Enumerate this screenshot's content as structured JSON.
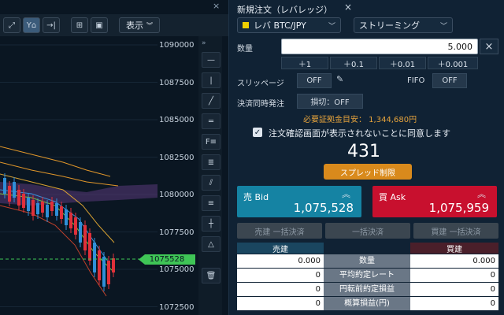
{
  "chart": {
    "toolbar": {
      "display_label": "表示",
      "buttons": [
        "fit-icon",
        "indicator-icon",
        "jump-icon",
        "add-chart-icon",
        "image-icon"
      ]
    },
    "y_axis_ticks": [
      "1090000",
      "1087500",
      "1085000",
      "1082500",
      "1080000",
      "1077500",
      "1075000",
      "1072500"
    ],
    "current_price": "1075528",
    "collapse_label": "»",
    "close_label": "×"
  },
  "order": {
    "title": "新規注文（レバレッジ）",
    "close_label": "×",
    "symbol_label": "レバ BTC/JPY",
    "mode_label": "ストリーミング",
    "quantity_label": "数量",
    "quantity_value": "5.000",
    "quantity_clear": "×",
    "increments": [
      "＋1",
      "＋0.1",
      "＋0.01",
      "＋0.001"
    ],
    "slippage_label": "スリッページ",
    "slippage_value": "OFF",
    "fifo_label": "FIFO",
    "fifo_value": "OFF",
    "settle_label": "決済同時発注",
    "settle_value": "損切：OFF",
    "margin_text": "必要証拠金目安： 1,344,680円",
    "agree_mark": "✓",
    "agree_text": "注文確認画面が表示されないことに同意します",
    "spread": "431",
    "spread_button": "スプレッド制限",
    "bid_label": "売 Bid",
    "bid_price": "1,075,528",
    "ask_label": "買 Ask",
    "ask_price": "1,075,959",
    "chevrons": "︽",
    "close_sell_all": "売建 一括決済",
    "close_all": "一括決済",
    "close_buy_all": "買建 一括決済",
    "table": {
      "sell_header": "売建",
      "buy_header": "買建",
      "rows": [
        {
          "left": "0.000",
          "label": "数量",
          "right": "0.000"
        },
        {
          "left": "0",
          "label": "平均約定レート",
          "right": "0"
        },
        {
          "left": "0",
          "label": "円転前約定損益",
          "right": "0"
        },
        {
          "left": "0",
          "label": "概算損益(円)",
          "right": "0"
        }
      ]
    }
  },
  "colors": {
    "bid": "#1583a3",
    "ask": "#c8102e",
    "up_candle": "#2f8fd8",
    "down_candle": "#e0303a",
    "price_line": "#3fc556",
    "accent_orange": "#d98a1c"
  }
}
